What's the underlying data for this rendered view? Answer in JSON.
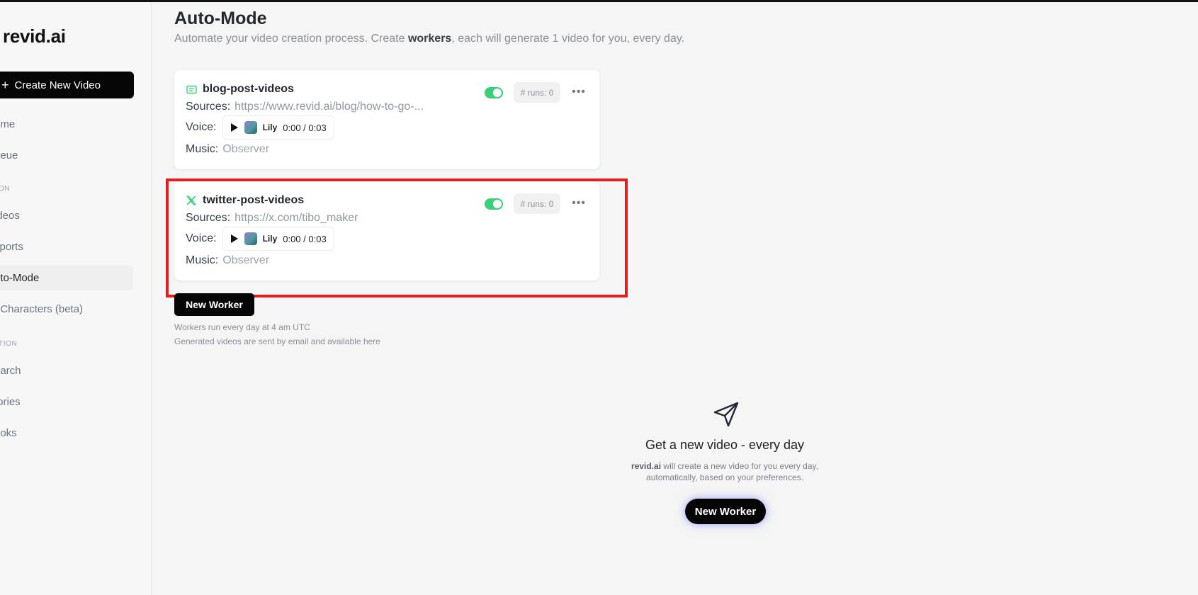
{
  "app": {
    "logo": "revid.ai"
  },
  "sidebar": {
    "create_button": "Create New Video",
    "items": [
      {
        "label": "ome"
      },
      {
        "label": "ueue"
      },
      {
        "label": "ideos"
      },
      {
        "label": "xports"
      },
      {
        "label": "uto-Mode"
      },
      {
        "label": "I Characters (beta)"
      },
      {
        "label": "earch"
      },
      {
        "label": "tories"
      },
      {
        "label": "ooks"
      }
    ],
    "sections": [
      "ON",
      "TION"
    ]
  },
  "header": {
    "title": "Auto-Mode",
    "subtitle_pre": "Automate your video creation process. Create ",
    "subtitle_bold": "workers",
    "subtitle_post": ", each will generate 1 video for you, every day."
  },
  "workers": [
    {
      "name": "blog-post-videos",
      "icon": "newspaper-icon",
      "sources_label": "Sources:",
      "source": "https://www.revid.ai/blog/how-to-go-...",
      "voice_label": "Voice:",
      "voice_name": "Lily",
      "voice_time": "0:00 / 0:03",
      "music_label": "Music:",
      "music": "Observer",
      "runs": "# runs: 0",
      "enabled": true
    },
    {
      "name": "twitter-post-videos",
      "icon": "x-logo-icon",
      "sources_label": "Sources:",
      "source": "https://x.com/tibo_maker",
      "voice_label": "Voice:",
      "voice_name": "Lily",
      "voice_time": "0:00 / 0:03",
      "music_label": "Music:",
      "music": "Observer",
      "runs": "# runs: 0",
      "enabled": true
    }
  ],
  "actions": {
    "new_worker": "New Worker"
  },
  "notes": {
    "schedule": "Workers run every day at 4 am UTC",
    "delivery": "Generated videos are sent by email and available here"
  },
  "empty_state": {
    "title": "Get a new video - every day",
    "desc_brand": "revid.ai",
    "desc_line1": " will create a new video for you every day,",
    "desc_line2": "automatically, based on your preferences.",
    "button": "New Worker"
  },
  "colors": {
    "accent_green": "#3ccf79",
    "highlight": "#e11d1d"
  }
}
